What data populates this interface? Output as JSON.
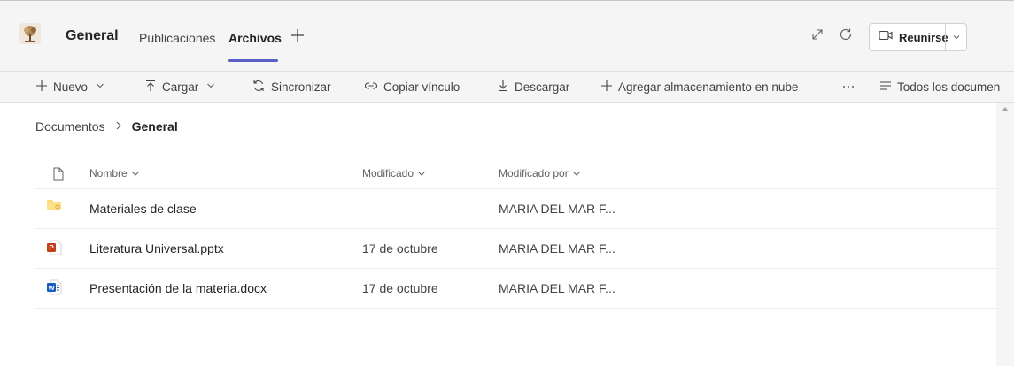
{
  "header": {
    "team_name": "General",
    "tabs": [
      {
        "label": "Publicaciones",
        "active": false
      },
      {
        "label": "Archivos",
        "active": true
      }
    ],
    "meet_button": "Reunirse",
    "accent": "#5b5fc7"
  },
  "toolbar": {
    "new": "Nuevo",
    "upload": "Cargar",
    "sync": "Sincronizar",
    "copy_link": "Copiar vínculo",
    "download": "Descargar",
    "add_storage": "Agregar almacenamiento en nube",
    "all_docs": "Todos los documen"
  },
  "breadcrumb": {
    "root": "Documentos",
    "current": "General"
  },
  "columns": {
    "name": "Nombre",
    "modified": "Modificado",
    "modified_by": "Modificado por"
  },
  "files": [
    {
      "name": "Materiales de clase",
      "modified": "",
      "modified_by": "MARIA DEL MAR F...",
      "icon": "folder-icon"
    },
    {
      "name": "Literatura Universal.pptx",
      "modified": "17 de octubre",
      "modified_by": "MARIA DEL MAR F...",
      "icon": "powerpoint-icon"
    },
    {
      "name": "Presentación de la materia.docx",
      "modified": "17 de octubre",
      "modified_by": "MARIA DEL MAR F...",
      "icon": "word-icon"
    }
  ]
}
